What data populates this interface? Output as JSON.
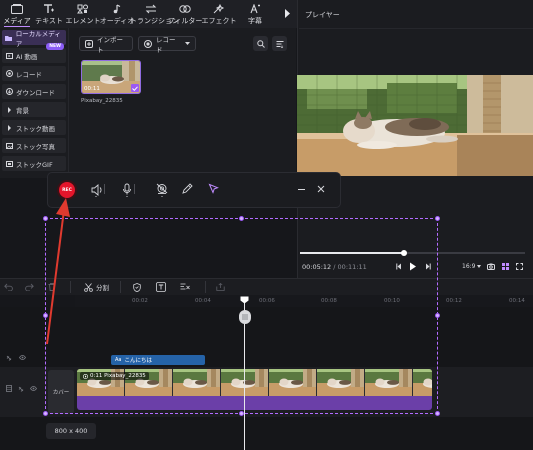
{
  "toolbar": {
    "items": [
      {
        "label": "メディア",
        "icon": "media-icon"
      },
      {
        "label": "テキスト",
        "icon": "text-icon"
      },
      {
        "label": "エレメント",
        "icon": "element-icon"
      },
      {
        "label": "オーディオ",
        "icon": "audio-icon"
      },
      {
        "label": "トランジション",
        "icon": "transition-icon"
      },
      {
        "label": "フィルター",
        "icon": "filter-icon"
      },
      {
        "label": "エフェクト",
        "icon": "effect-icon"
      },
      {
        "label": "字幕",
        "icon": "subtitle-icon"
      }
    ]
  },
  "sidebar": {
    "items": [
      {
        "label": "ローカルメディア"
      },
      {
        "label": "AI 動画",
        "badge": "NEW"
      },
      {
        "label": "レコード"
      },
      {
        "label": "ダウンロード"
      },
      {
        "label": "背景"
      },
      {
        "label": "ストック動画"
      },
      {
        "label": "ストック写真"
      },
      {
        "label": "ストックGIF"
      }
    ]
  },
  "media": {
    "import_label": "インポート",
    "record_label": "レコード",
    "clip": {
      "name": "Pixabay_22835",
      "duration": "00:11"
    }
  },
  "player": {
    "title": "プレイヤー",
    "current_time": "00:05:12",
    "total_time": "00:11:11",
    "aspect": "16:9",
    "progress": 0.46
  },
  "rec_toolbar": {
    "rec_label": "REC"
  },
  "timeline": {
    "split_label": "分割",
    "ruler_ticks": [
      "00:02",
      "00:04",
      "00:06",
      "00:08",
      "00:10",
      "00:12",
      "00:14"
    ],
    "text_clip_label": "こんにちは",
    "video_clip_label": "0:11 Pixabay_22835",
    "cover_label": "カバー",
    "canvas_size": "800 x 400"
  },
  "colors": {
    "accent": "#b26bff",
    "rec_red": "#e5152b",
    "text_clip": "#2563a8",
    "video_track": "#6b3fa8"
  }
}
